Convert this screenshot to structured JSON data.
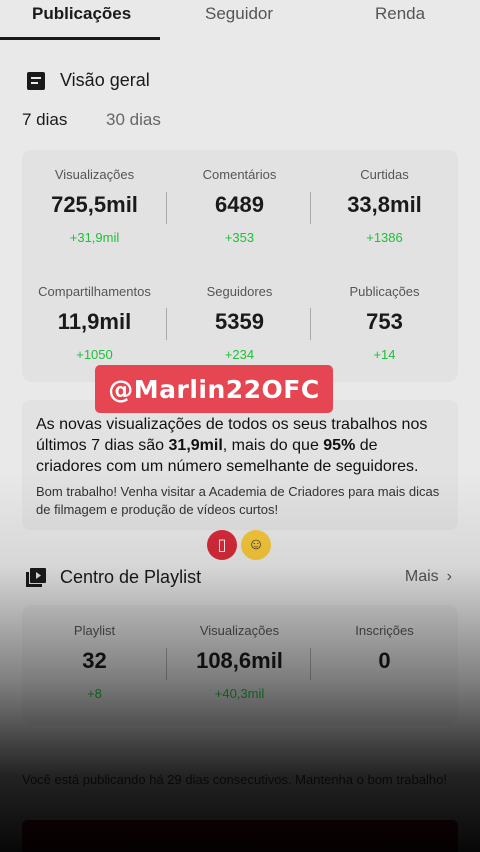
{
  "tabs": [
    {
      "label": "Publicações"
    },
    {
      "label": "Seguidor"
    },
    {
      "label": "Renda"
    }
  ],
  "overview": {
    "title": "Visão geral",
    "periods": [
      "7 dias",
      "30 dias"
    ],
    "stats_row1": [
      {
        "label": "Visualizações",
        "value": "725,5mil",
        "delta": "+31,9mil"
      },
      {
        "label": "Comentários",
        "value": "6489",
        "delta": "+353"
      },
      {
        "label": "Curtidas",
        "value": "33,8mil",
        "delta": "+1386"
      }
    ],
    "stats_row2": [
      {
        "label": "Compartilhamentos",
        "value": "11,9mil",
        "delta": "+1050"
      },
      {
        "label": "Seguidores",
        "value": "5359",
        "delta": "+234"
      },
      {
        "label": "Publicações",
        "value": "753",
        "delta": "+14"
      }
    ]
  },
  "watermark": "@Marlin22OFC",
  "insight": {
    "text_before": "As novas visualizações de todos os seus trabalhos nos últimos 7 dias são ",
    "highlight_value": "31,9mil",
    "text_middle": ", mais do que ",
    "highlight_percent": "95%",
    "text_after": " de criadores com um número semelhante de seguidores.",
    "sub": "Bom trabalho! Venha visitar a Academia de Criadores para mais dicas de filmagem e produção de vídeos curtos!"
  },
  "playlist": {
    "title": "Centro de Playlist",
    "more": "Mais",
    "stats": [
      {
        "label": "Playlist",
        "value": "32",
        "delta": "+8"
      },
      {
        "label": "Visualizações",
        "value": "108,6mil",
        "delta": "+40,3mil"
      },
      {
        "label": "Inscrições",
        "value": "0",
        "delta": ""
      }
    ]
  },
  "footer": {
    "text": "Você está publicando há 29 dias consecutivos. Mantenha o bom trabalho!"
  },
  "icons": {
    "overview": "document-icon",
    "playlist": "playlist-icon",
    "emoji_1": "no-phone-icon",
    "emoji_2": "sunshine-face-icon"
  },
  "colors": {
    "accent_green": "#1fbf3a",
    "watermark_red": "#e64552",
    "button_red": "#8a0f15"
  }
}
